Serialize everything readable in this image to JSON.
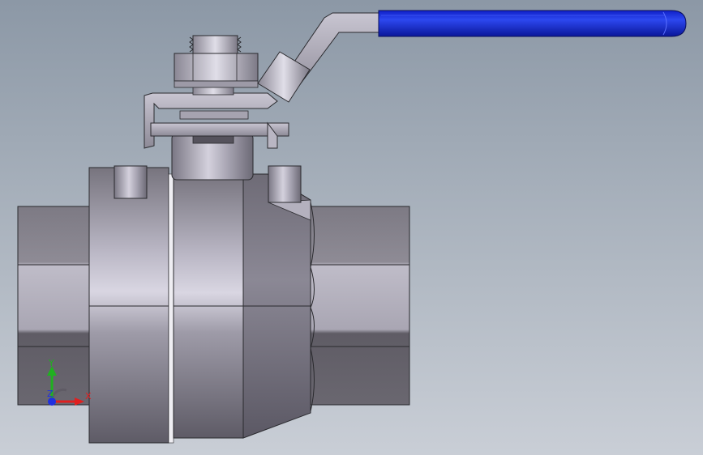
{
  "viewport": {
    "background_top": "#8c98a6",
    "background_bottom": "#c9ced6"
  },
  "model": {
    "part": "ball-valve",
    "handle_grip_color": "#1a2fd6",
    "body_color": "#8f8c97",
    "metal_highlight": "#d2cfdb"
  },
  "triad": {
    "x_label": "X",
    "y_label": "Y",
    "z_label": "Z",
    "x_color": "#e02020",
    "y_color": "#20b020",
    "z_color": "#2030e0"
  }
}
